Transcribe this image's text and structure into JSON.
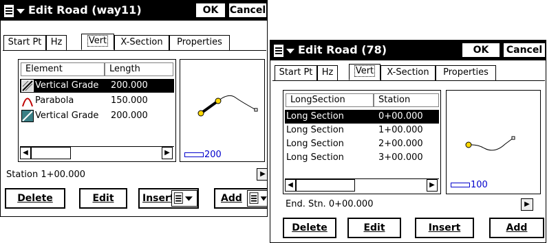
{
  "win1": {
    "title": "Edit Road (way11)",
    "ok": "OK",
    "cancel": "Cancel",
    "tabs": [
      "Start Pt",
      "Hz",
      "Vert",
      "X-Section",
      "Properties"
    ],
    "active_tab": "Vert",
    "list": {
      "columns": [
        "Element",
        "Length"
      ],
      "rows": [
        {
          "icon": "vertical-grade-icon",
          "element": "Vertical Grade",
          "length": "200.000",
          "selected": true
        },
        {
          "icon": "parabola-icon",
          "element": "Parabola",
          "length": "150.000",
          "selected": false
        },
        {
          "icon": "vertical-grade-icon",
          "element": "Vertical Grade",
          "length": "200.000",
          "selected": false
        }
      ]
    },
    "scale": "200",
    "status": "Station 1+00.000",
    "buttons": {
      "delete": "Delete",
      "edit": "Edit",
      "insert": "Insert",
      "add": "Add"
    }
  },
  "win2": {
    "title": "Edit Road (78)",
    "ok": "OK",
    "cancel": "Cancel",
    "tabs": [
      "Start Pt",
      "Hz",
      "Vert",
      "X-Section",
      "Properties"
    ],
    "active_tab": "Vert",
    "list": {
      "columns": [
        "LongSection",
        "Station"
      ],
      "rows": [
        {
          "name": "Long Section",
          "station": "0+00.000",
          "selected": true
        },
        {
          "name": "Long Section",
          "station": "1+00.000",
          "selected": false
        },
        {
          "name": "Long Section",
          "station": "2+00.000",
          "selected": false
        },
        {
          "name": "Long Section",
          "station": "3+00.000",
          "selected": false
        }
      ]
    },
    "scale": "100",
    "status": "End. Stn. 0+00.000",
    "buttons": {
      "delete": "Delete",
      "edit": "Edit",
      "insert": "Insert",
      "add": "Add"
    }
  },
  "colors": {
    "accent": "#000000",
    "selection": "#000000",
    "scale": "#0000cc",
    "node": "#ffd800"
  }
}
